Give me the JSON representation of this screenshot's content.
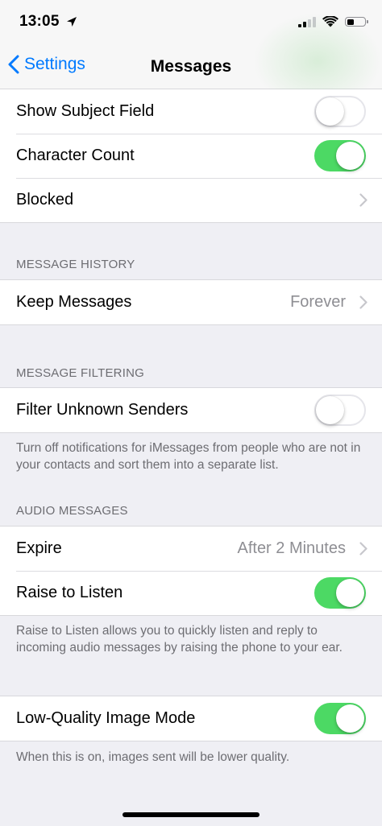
{
  "status_bar": {
    "time": "13:05"
  },
  "nav": {
    "back_label": "Settings",
    "title": "Messages"
  },
  "group1": {
    "show_subject": {
      "label": "Show Subject Field",
      "enabled": false
    },
    "character_count": {
      "label": "Character Count",
      "enabled": true
    },
    "blocked": {
      "label": "Blocked"
    }
  },
  "message_history": {
    "header": "MESSAGE HISTORY",
    "keep_messages": {
      "label": "Keep Messages",
      "value": "Forever"
    }
  },
  "message_filtering": {
    "header": "MESSAGE FILTERING",
    "filter_unknown": {
      "label": "Filter Unknown Senders",
      "enabled": false
    },
    "footer": "Turn off notifications for iMessages from people who are not in your contacts and sort them into a separate list."
  },
  "audio_messages": {
    "header": "AUDIO MESSAGES",
    "expire": {
      "label": "Expire",
      "value": "After 2 Minutes"
    },
    "raise_to_listen": {
      "label": "Raise to Listen",
      "enabled": true
    },
    "footer": "Raise to Listen allows you to quickly listen and reply to incoming audio messages by raising the phone to your ear."
  },
  "low_quality": {
    "label": "Low-Quality Image Mode",
    "enabled": true,
    "footer": "When this is on, images sent will be lower quality."
  },
  "colors": {
    "accent": "#007aff",
    "toggle_on": "#4cd964",
    "secondary_text": "#8e8e93"
  }
}
